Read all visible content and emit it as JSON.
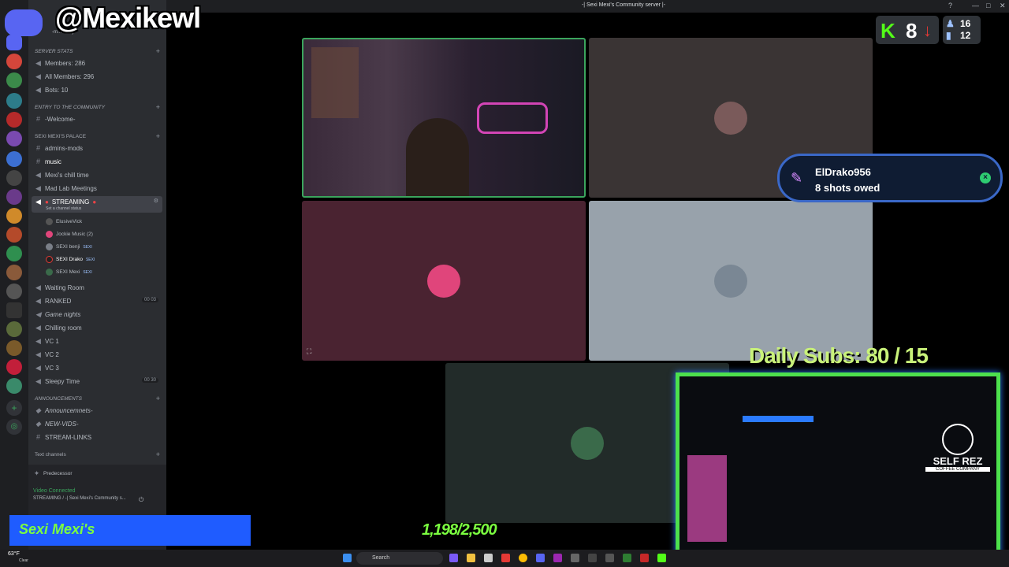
{
  "window": {
    "title": "-| Sexi Mexi's Community server |-"
  },
  "overlay": {
    "handle": "@Mexikewl",
    "kick_viewers": "8",
    "kick_logo": "K",
    "stat_top": "16",
    "stat_bottom": "12",
    "notification": {
      "name": "ElDrako956",
      "message": "8 shots owed"
    },
    "daily_subs": "Daily Subs:  80 / 15",
    "bar_text": "Sexi Mexi's",
    "goal": "1,198/2,500",
    "brand": "SELF REZ",
    "brand_sub": "COFFEE COMPANY"
  },
  "sidebar": {
    "server_tag": "-m...ff-only-",
    "categories": {
      "stats": "SERVER STATS",
      "entry": "ENTRY TO THE COMMUNITY",
      "palace": "SEXI MEXI'S PALACE",
      "announcements": "ANNOUNCEMENTS",
      "text": "Text channels"
    },
    "stats": [
      "Members: 286",
      "All Members: 296",
      "Bots: 10"
    ],
    "welcome": "-Welcome-",
    "palace_channels": [
      "admins-mods",
      "music",
      "Mexi's chill time",
      "Mad Lab Meetings"
    ],
    "streaming": "STREAMING",
    "channel_status": "Set a channel status",
    "users": [
      "ElusiveVick",
      "Jockie Music (2)",
      "SEXI benji",
      "SEXI Drako",
      "SEXI Mexi"
    ],
    "user_tag": "SEXI",
    "voice_channels": [
      "Waiting Room",
      "RANKED",
      "Game nights",
      "Chilling room",
      "VC 1",
      "VC 2",
      "VC 3",
      "Sleepy Time"
    ],
    "ranked_count": "00 03",
    "sleepy_count": "00 30",
    "announcement_channels": [
      "Announcemnets-",
      "NEW-VIDS-",
      "STREAM-LINKS"
    ],
    "activity": "Predecessor",
    "video_connected": "Video Connected",
    "voice_location": "STREAMING / -| Sexi Mexi's Community s..."
  },
  "taskbar": {
    "search": "Search",
    "weather_temp": "63°F",
    "weather_desc": "Clear"
  },
  "colors": {
    "kick_green": "#53fc18",
    "discord_bg": "#2b2d31",
    "frame_green": "#4de04d",
    "bar_blue": "#1f5cff"
  }
}
